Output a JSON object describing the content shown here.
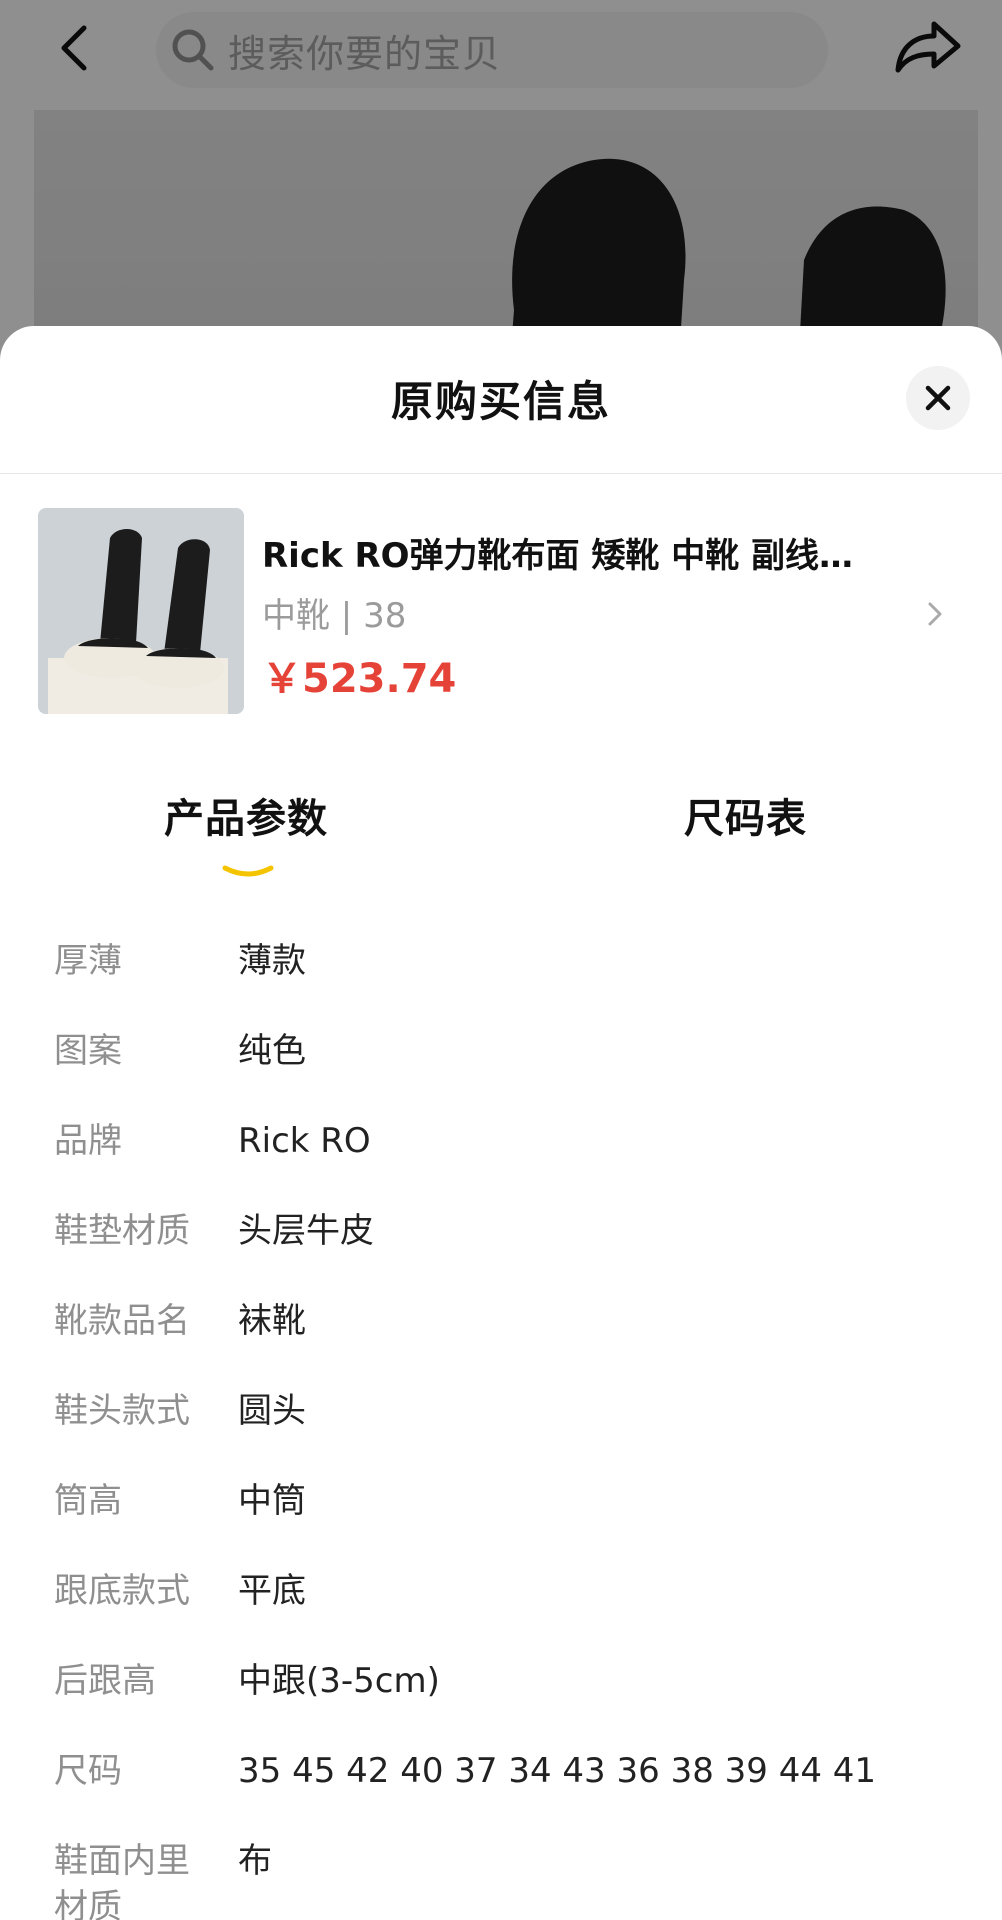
{
  "topbar": {
    "search_placeholder": "搜索你要的宝贝"
  },
  "sheet": {
    "title": "原购买信息",
    "product": {
      "title": "Rick RO弹力靴布面 矮靴 中靴 副线…",
      "variant": "中靴 | 38",
      "price": "￥523.74"
    },
    "tabs": [
      {
        "label": "产品参数",
        "active": true
      },
      {
        "label": "尺码表",
        "active": false
      }
    ],
    "params": [
      {
        "label": "厚薄",
        "value": "薄款"
      },
      {
        "label": "图案",
        "value": "纯色"
      },
      {
        "label": "品牌",
        "value": "Rick RO"
      },
      {
        "label": "鞋垫材质",
        "value": "头层牛皮"
      },
      {
        "label": "靴款品名",
        "value": "袜靴"
      },
      {
        "label": "鞋头款式",
        "value": "圆头"
      },
      {
        "label": "筒高",
        "value": "中筒"
      },
      {
        "label": "跟底款式",
        "value": "平底"
      },
      {
        "label": "后跟高",
        "value": "中跟(3-5cm)"
      },
      {
        "label": "尺码",
        "value": "35 45 42 40 37 34 43 36 38 39 44 41"
      },
      {
        "label": "鞋面内里材质",
        "value": "布"
      }
    ]
  },
  "colors": {
    "price": "#e64338",
    "tab_indicator": "#f5c400"
  }
}
